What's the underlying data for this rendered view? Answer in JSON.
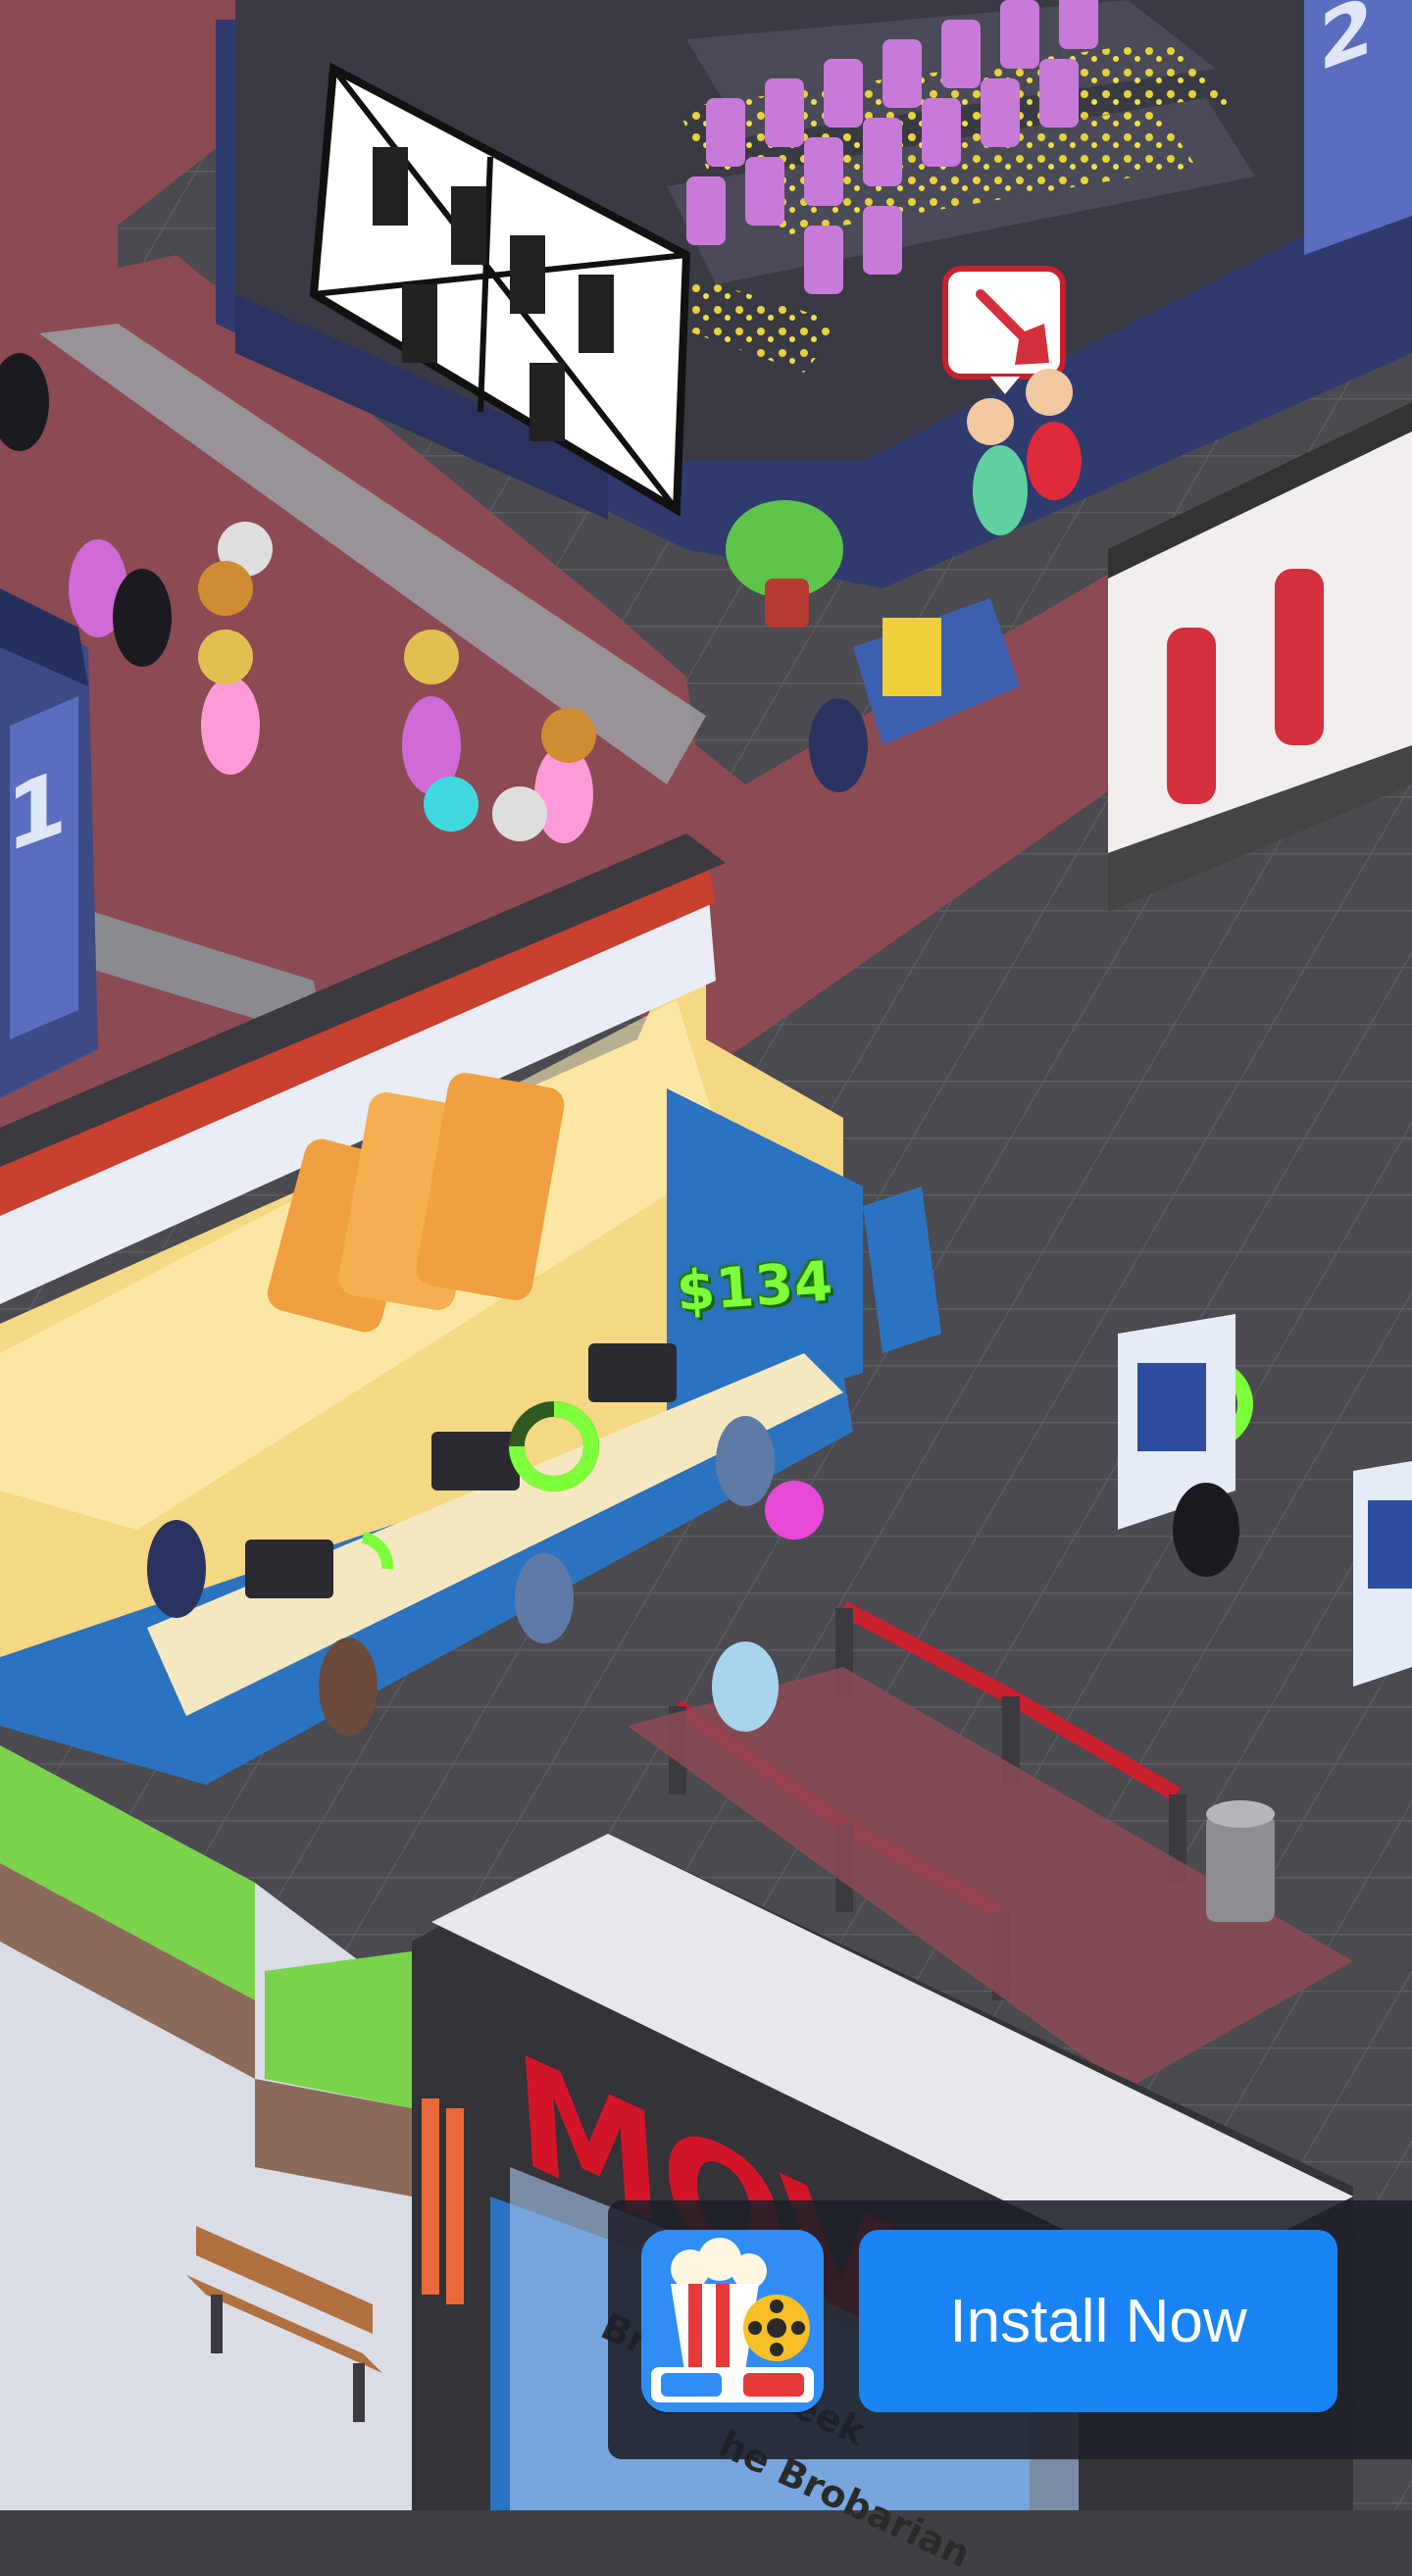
{
  "hud": {
    "money_popup": "$134"
  },
  "scene": {
    "screen_numbers": [
      "1",
      "2"
    ],
    "marquee_title": "MOVI",
    "marquee_poster_line1": "Br",
    "marquee_poster_line2": "eek",
    "marquee_poster_line3": "he Brobarian"
  },
  "ad": {
    "install_label": "Install Now",
    "icon": "popcorn-film-3d-glasses-icon"
  },
  "colors": {
    "carpet": "#8c4a52",
    "floor_tile": "#4a4a50",
    "theater_wall": "#3c4a86",
    "seats": "#c77ad8",
    "ticket_counter": "#f5d884",
    "install_button": "#1a84f6",
    "money_text": "#7dff3a"
  }
}
